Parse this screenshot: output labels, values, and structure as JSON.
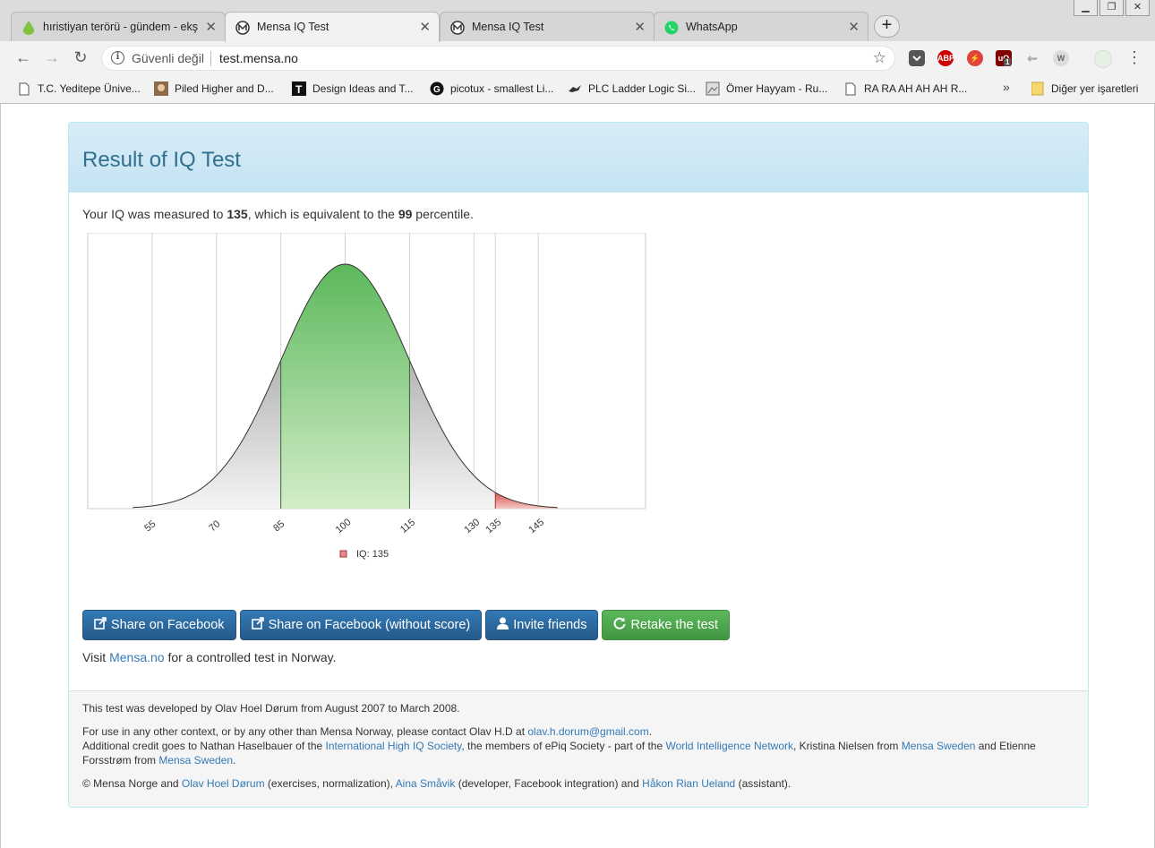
{
  "browser": {
    "tabs": [
      {
        "label": "hıristiyan terörü - gündem - ekşi",
        "favicon": "drop-icon",
        "active": false
      },
      {
        "label": "Mensa IQ Test",
        "favicon": "mensa-icon",
        "active": true
      },
      {
        "label": "Mensa IQ Test",
        "favicon": "mensa-icon",
        "active": false
      },
      {
        "label": "WhatsApp",
        "favicon": "whatsapp-icon",
        "active": false
      }
    ],
    "address": {
      "security_label": "Güvenli değil",
      "url": "test.mensa.no"
    },
    "extensions": [
      "pocket-icon",
      "adblock-icon",
      "extension-red-icon",
      "ublock-icon",
      "extension-grey-icon",
      "wikipedia-icon",
      "profile-icon"
    ],
    "ublock_badge": "1",
    "bookmarks": [
      {
        "label": "T.C. Yeditepe Ünive...",
        "icon": "page-icon"
      },
      {
        "label": "Piled Higher and D...",
        "icon": "comic-icon"
      },
      {
        "label": "Design Ideas and T...",
        "icon": "t-logo-icon"
      },
      {
        "label": "picotux - smallest Li...",
        "icon": "globe-icon"
      },
      {
        "label": "PLC Ladder Logic Si...",
        "icon": "bird-icon"
      },
      {
        "label": "Ömer Hayyam - Ru...",
        "icon": "image-icon"
      },
      {
        "label": "RA RA AH AH AH R...",
        "icon": "page-icon"
      }
    ],
    "bookmarks_more": "»",
    "other_bookmarks": "Diğer yer işaretleri"
  },
  "panel": {
    "title": "Result of IQ Test",
    "result": {
      "prefix": "Your IQ was measured to ",
      "iq": "135",
      "middle": ", which is equivalent to the ",
      "percentile": "99",
      "suffix": " percentile."
    },
    "buttons": {
      "share": "Share on Facebook",
      "share_no_score": "Share on Facebook (without score)",
      "invite": "Invite friends",
      "retake": "Retake the test"
    },
    "visit": {
      "prefix": "Visit ",
      "link": "Mensa.no",
      "suffix": " for a controlled test in Norway."
    }
  },
  "footer": {
    "line1": "This test was developed by Olav Hoel Dørum from August 2007 to March 2008.",
    "contact_prefix": "For use in any other context, or by any other than Mensa Norway, please contact Olav H.D at ",
    "contact_email": "olav.h.dorum@gmail.com",
    "contact_suffix": ".",
    "credit_prefix": "Additional credit goes to Nathan Haselbauer of the ",
    "credit_link1": "International High IQ Society",
    "credit_mid1": ", the members of ePiq Society - part of the ",
    "credit_link2": "World Intelligence Network",
    "credit_mid2": ", Kristina Nielsen from ",
    "credit_link3": "Mensa Sweden",
    "credit_mid3": " and Etienne Forsstrøm from ",
    "credit_link4": "Mensa Sweden",
    "credit_suffix": ".",
    "copy_prefix": "© Mensa Norge and ",
    "copy_link1": "Olav Hoel Dørum",
    "copy_mid1": " (exercises, normalization), ",
    "copy_link2": "Aina Småvik",
    "copy_mid2": " (developer, Facebook integration) and ",
    "copy_link3": "Håkon Rian Ueland",
    "copy_suffix": " (assistant)."
  },
  "chart_data": {
    "type": "area",
    "description_series": "IQ distribution curve (mean 100, SD 15)",
    "mean": 100,
    "sd": 15,
    "x_ticks": [
      "55",
      "70",
      "85",
      "100",
      "115",
      "130",
      "135",
      "145"
    ],
    "xlim": [
      40,
      170
    ],
    "highlight_band": [
      85,
      115
    ],
    "highlight_band_color": "#5cb85c",
    "score_marker": 135,
    "score_tail_color": "#d9534f",
    "legend": "IQ: 135",
    "legend_position": "bottom"
  }
}
